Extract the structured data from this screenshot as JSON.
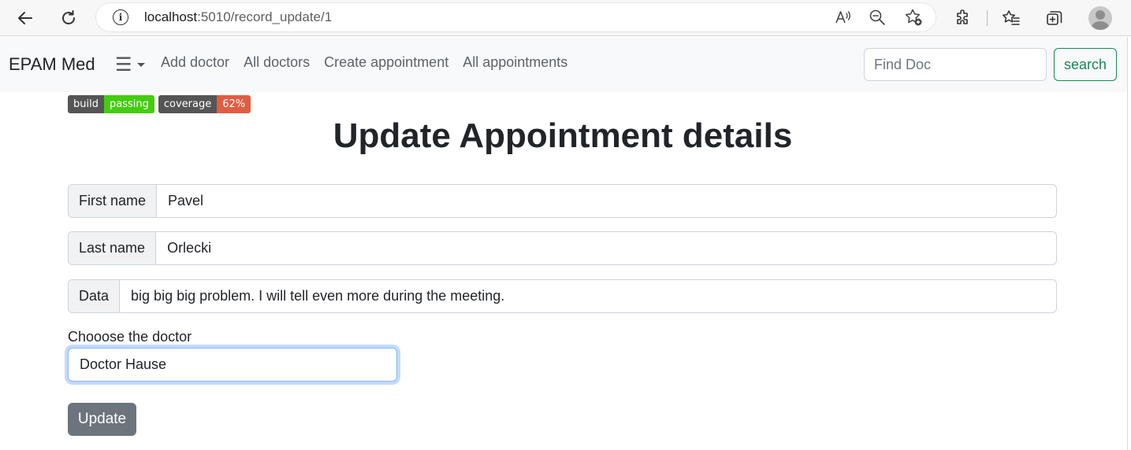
{
  "browser": {
    "url_host": "localhost",
    "url_path": ":5010/record_update/1"
  },
  "navbar": {
    "brand": "EPAM Med",
    "links": [
      "Add doctor",
      "All doctors",
      "Create appointment",
      "All appointments"
    ],
    "search_placeholder": "Find Doc",
    "search_button": "search"
  },
  "badges": [
    {
      "key": "build",
      "value": "passing",
      "color": "#44cc11"
    },
    {
      "key": "coverage",
      "value": "62%",
      "color": "#e05d44"
    }
  ],
  "form": {
    "title": "Update Appointment details",
    "first_name_label": "First name",
    "first_name_value": "Pavel",
    "last_name_label": "Last name",
    "last_name_value": "Orlecki",
    "data_label": "Data",
    "data_value": "big big big problem. I will tell even more during the meeting.",
    "doctor_select_label": "Chooose the doctor",
    "doctor_selected": "Doctor Hause",
    "submit_label": "Update"
  }
}
